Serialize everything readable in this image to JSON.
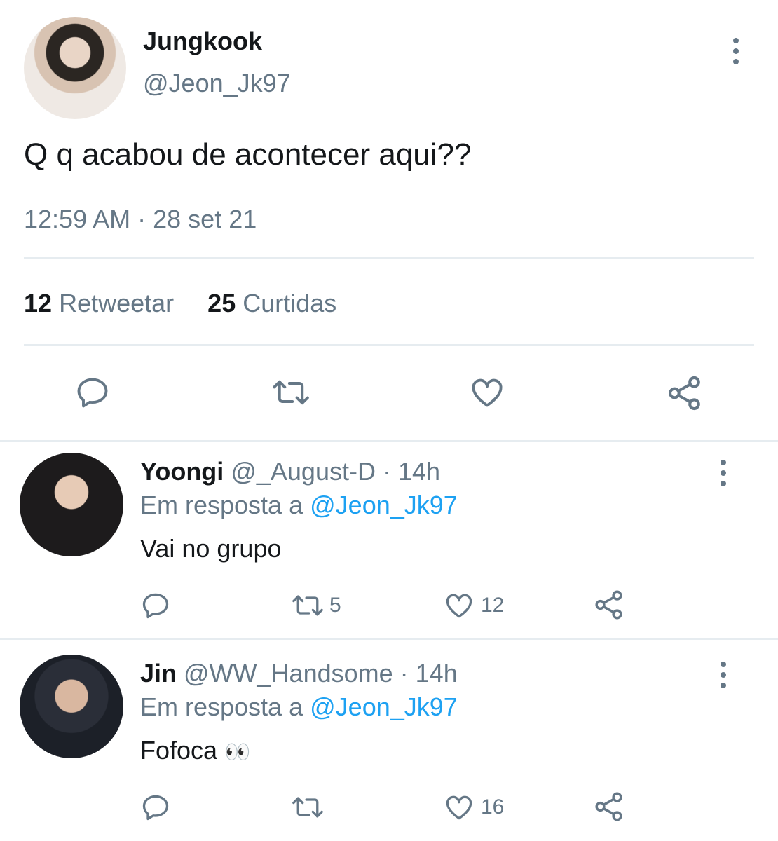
{
  "tweet": {
    "author_name": "Jungkook",
    "handle": "@Jeon_Jk97",
    "text": "Q q acabou de acontecer aqui??",
    "time": "12:59 AM",
    "dot": "·",
    "date": "28 set 21",
    "retweets_count": "12",
    "retweets_label": "Retweetar",
    "likes_count": "25",
    "likes_label": "Curtidas",
    "icons": [
      "reply-icon",
      "retweet-icon",
      "like-icon",
      "share-icon",
      "more-options-icon"
    ]
  },
  "replies": [
    {
      "name": "Yoongi",
      "handle": "@_August-D",
      "time": "· 14h",
      "reply_prefix": "Em resposta a",
      "reply_to": "@Jeon_Jk97",
      "text": "Vai no grupo",
      "emoji": "",
      "retweets": "5",
      "likes": "12"
    },
    {
      "name": "Jin",
      "handle": "@WW_Handsome",
      "time": "· 14h",
      "reply_prefix": "Em resposta a",
      "reply_to": "@Jeon_Jk97",
      "text": "Fofoca",
      "emoji": "👀",
      "retweets": "",
      "likes": "16"
    }
  ],
  "colors": {
    "accent": "#1da1f2",
    "muted": "#657786",
    "divider": "#e6ecf0"
  }
}
